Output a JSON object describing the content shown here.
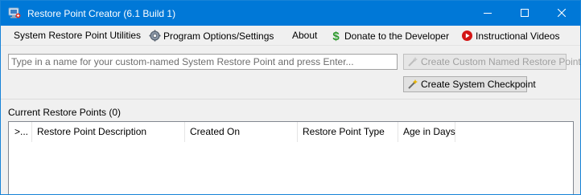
{
  "window": {
    "title": "Restore Point Creator (6.1 Build 1)"
  },
  "menu": {
    "items": [
      {
        "label": "System Restore Point Utilities",
        "icon": ""
      },
      {
        "label": "Program Options/Settings",
        "icon": "gear-icon"
      },
      {
        "label": "About",
        "icon": ""
      },
      {
        "label": "Donate to the Developer",
        "icon": "dollar-icon"
      },
      {
        "label": "Instructional Videos",
        "icon": "play-icon"
      }
    ]
  },
  "restore_point": {
    "name_placeholder": "Type in a name for your custom-named System Restore Point and press Enter...",
    "name_value": "",
    "create_named_label": "Create Custom Named Restore Point",
    "create_checkpoint_label": "Create System Checkpoint"
  },
  "restore_points": {
    "label": "Current Restore Points (0)",
    "columns": [
      ">...",
      "Restore Point Description",
      "Created On",
      "Restore Point Type",
      "Age in Days"
    ],
    "rows": []
  },
  "colors": {
    "titlebar": "#0078d7",
    "close_icon": "#ffffff",
    "dollar_icon": "#2e9a2e",
    "play_icon": "#d31515"
  }
}
